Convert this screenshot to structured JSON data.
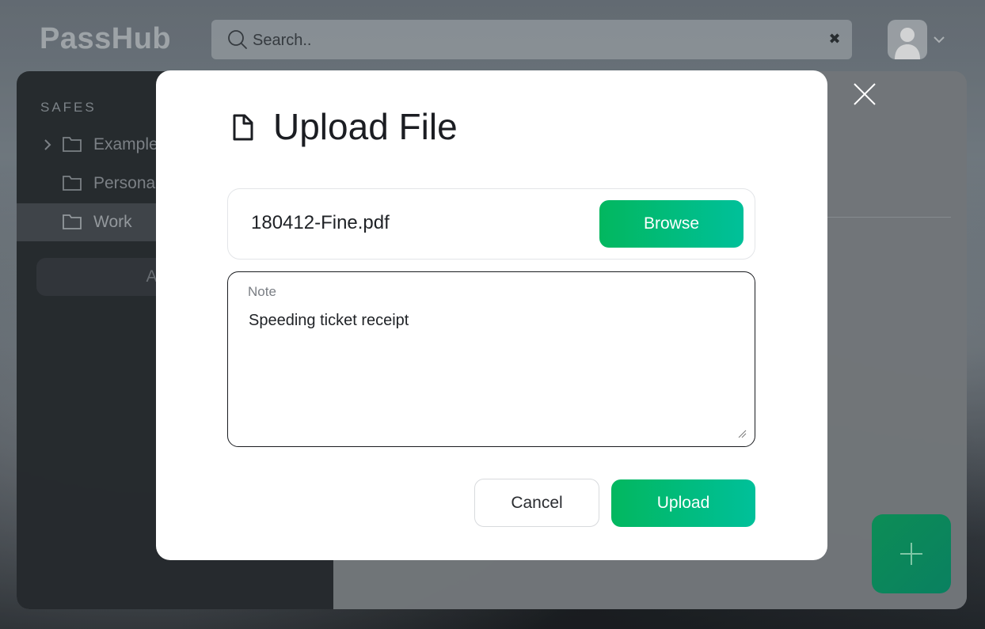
{
  "app": {
    "logo_text": "PassHub"
  },
  "search": {
    "placeholder": "Search.."
  },
  "sidebar": {
    "heading": "SAFES",
    "safes": [
      {
        "label": "Example",
        "expandable": true,
        "active": false
      },
      {
        "label": "Personal",
        "expandable": false,
        "active": false
      },
      {
        "label": "Work",
        "expandable": false,
        "active": true
      }
    ],
    "add_safe_label": "Add safe"
  },
  "modal": {
    "title": "Upload File",
    "icon": "file-icon",
    "file_name": "180412-Fine.pdf",
    "browse_label": "Browse",
    "note_label": "Note",
    "note_value": "Speeding ticket receipt",
    "cancel_label": "Cancel",
    "upload_label": "Upload"
  },
  "colors": {
    "accent_start": "#02b75f",
    "accent_end": "#00c09a",
    "fab": "#0c8d56"
  }
}
